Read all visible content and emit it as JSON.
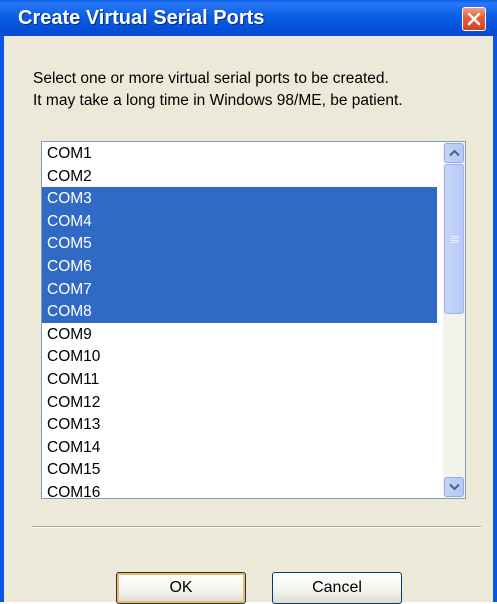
{
  "window": {
    "title": "Create Virtual Serial Ports"
  },
  "icons": {
    "close": "close-icon",
    "scroll_up": "scroll-up-arrow-icon",
    "scroll_down": "scroll-down-arrow-icon"
  },
  "colors": {
    "title_bar": "#0a54e6",
    "selection": "#316ac5",
    "dialog_background": "#ece9d8",
    "close_button": "#e6603c"
  },
  "message": {
    "line1": "Select one or more virtual serial ports to be created.",
    "line2": "It may take a long time in Windows 98/ME, be patient."
  },
  "ports": [
    {
      "label": "COM1",
      "selected": false
    },
    {
      "label": "COM2",
      "selected": false
    },
    {
      "label": "COM3",
      "selected": true
    },
    {
      "label": "COM4",
      "selected": true
    },
    {
      "label": "COM5",
      "selected": true
    },
    {
      "label": "COM6",
      "selected": true
    },
    {
      "label": "COM7",
      "selected": true
    },
    {
      "label": "COM8",
      "selected": true
    },
    {
      "label": "COM9",
      "selected": false
    },
    {
      "label": "COM10",
      "selected": false
    },
    {
      "label": "COM11",
      "selected": false
    },
    {
      "label": "COM12",
      "selected": false
    },
    {
      "label": "COM13",
      "selected": false
    },
    {
      "label": "COM14",
      "selected": false
    },
    {
      "label": "COM15",
      "selected": false
    },
    {
      "label": "COM16",
      "selected": false
    }
  ],
  "buttons": {
    "ok": "OK",
    "cancel": "Cancel"
  }
}
